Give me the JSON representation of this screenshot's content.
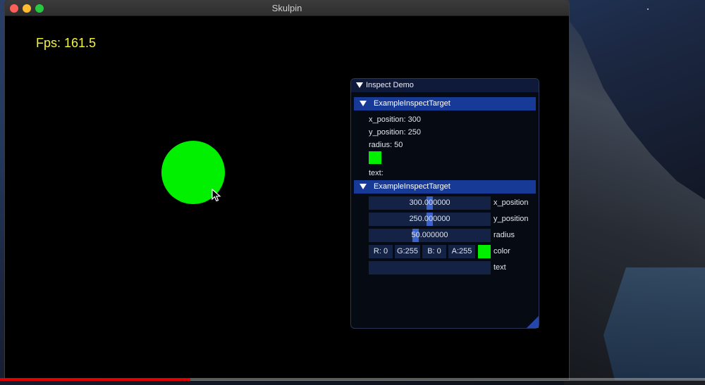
{
  "window": {
    "title": "Skulpin"
  },
  "overlay": {
    "fps": "Fps: 161.5"
  },
  "shape": {
    "color": "#00f000"
  },
  "panel": {
    "title": "Inspect Demo",
    "sections": [
      {
        "header": "ExampleInspectTarget",
        "lines": [
          "x_position: 300",
          "y_position: 250",
          "radius: 50"
        ],
        "text_label": "text:"
      },
      {
        "header": "ExampleInspectTarget",
        "fields": [
          {
            "value": "300.000000",
            "label": "x_position"
          },
          {
            "value": "250.000000",
            "label": "y_position"
          },
          {
            "value": "50.000000",
            "label": "radius"
          }
        ],
        "color": {
          "r": "R:  0",
          "g": "G:255",
          "b": "B:  0",
          "a": "A:255",
          "label": "color"
        },
        "text_label": "text"
      }
    ]
  },
  "video": {
    "progress": 0.27,
    "accent": "#e00000"
  },
  "icons": [
    "close-icon",
    "minimize-icon",
    "maximize-icon",
    "arrow-cursor-icon",
    "collapse-triangle-icon",
    "resize-grip-icon"
  ]
}
